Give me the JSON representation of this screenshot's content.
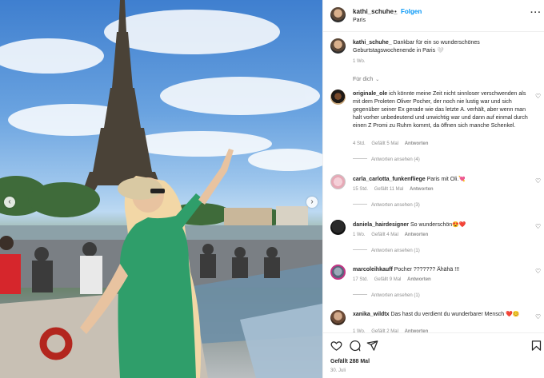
{
  "post": {
    "username": "kathi_schuhe_",
    "follow_label": "Folgen",
    "separator": "•",
    "location": "Paris",
    "more_label": "···",
    "caption": "Dankbar für ein so wunderschönes Geburtstagswochenende in Paris 🤍",
    "caption_time": "1 Wo."
  },
  "sort_label": "Für dich",
  "comments": [
    {
      "username": "originale_ole",
      "text": "ich könnte meine Zeit nicht sinnloser verschwenden als mit dem Proleten Oliver Pocher, der noch nie lustig war und sich gegenüber seiner Ex gerade wie das letzte A. verhält, aber wenn man halt vorher unbedeutend und unwichtig war und dann auf einmal durch einen Z Promi zu Ruhm kommt, da öffnen sich manche Schenkel.",
      "time": "4 Std.",
      "likes": "Gefällt 5 Mal",
      "reply": "Antworten",
      "view_replies": "Antworten ansehen (4)"
    },
    {
      "username": "carla_carlotta_funkenfliege",
      "text": "Paris mit Oli.💘",
      "time": "15 Std.",
      "likes": "Gefällt 11 Mal",
      "reply": "Antworten",
      "view_replies": "Antworten ansehen (3)"
    },
    {
      "username": "daniela_hairdesigner",
      "text": "So wunderschön😍❤️",
      "time": "1 Wo.",
      "likes": "Gefällt 4 Mal",
      "reply": "Antworten",
      "view_replies": "Antworten ansehen (1)"
    },
    {
      "username": "marcoleihkauff",
      "text": "Pocher ??????? Ähähä !!!",
      "time": "17 Std.",
      "likes": "Gefällt 9 Mal",
      "reply": "Antworten",
      "view_replies": "Antworten ansehen (1)"
    },
    {
      "username": "xanika_wildtx",
      "text": "Das hast du verdient du wunderbarer Mensch ❤️😊",
      "time": "1 Wo.",
      "likes": "Gefällt 2 Mal",
      "reply": "Antworten"
    }
  ],
  "actions": {
    "likes": "Gefällt 288 Mal",
    "date": "30. Juli"
  },
  "colors": {
    "accent": "#0095f6",
    "text": "#262626",
    "secondary": "#8e8e8e",
    "divider": "#efefef"
  },
  "icons": [
    "heart-icon",
    "comment-icon",
    "share-icon",
    "bookmark-icon",
    "more-icon",
    "chevron-left-icon",
    "chevron-right-icon"
  ]
}
